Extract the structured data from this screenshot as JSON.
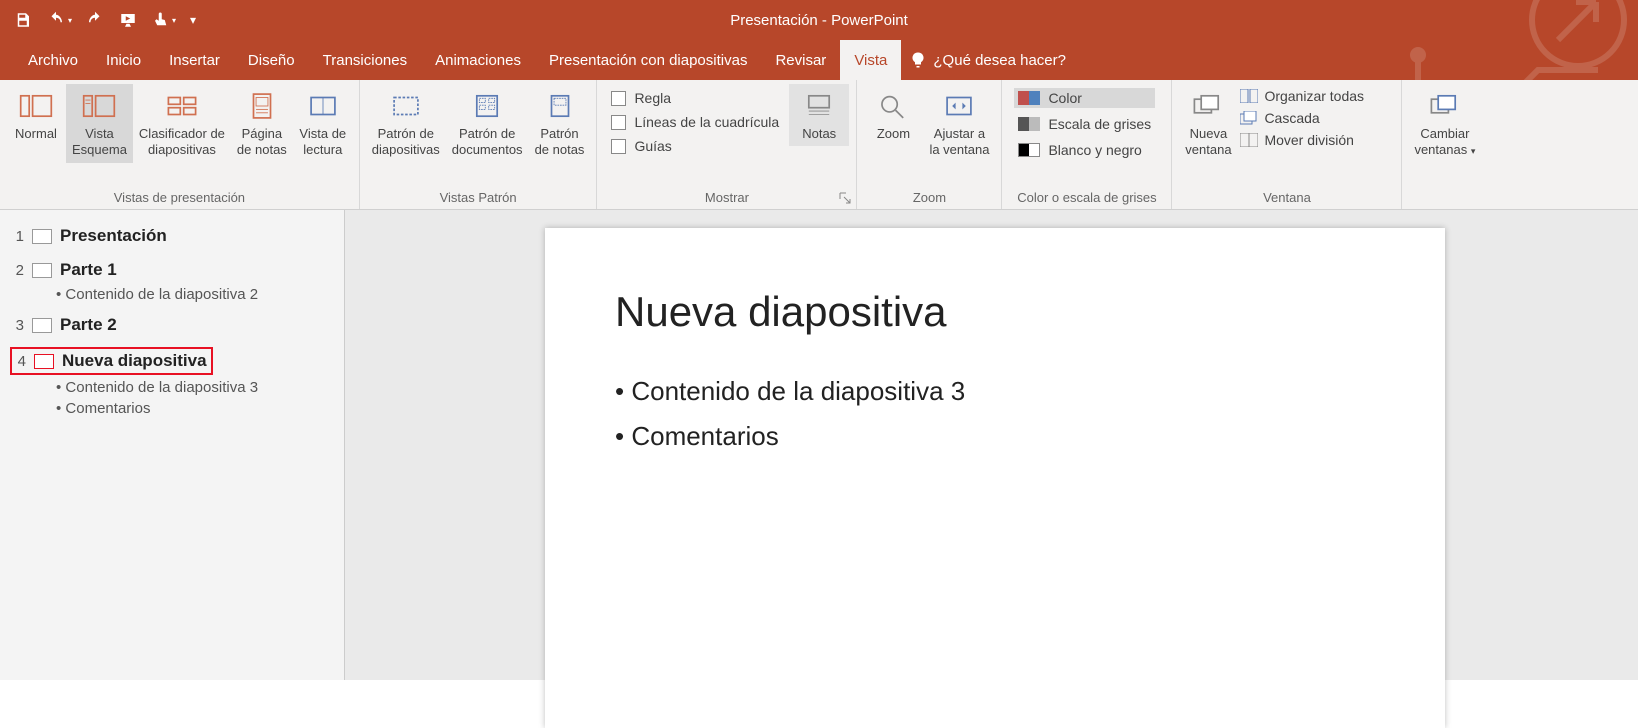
{
  "app": {
    "title": "Presentación - PowerPoint"
  },
  "tabs": {
    "items": [
      "Archivo",
      "Inicio",
      "Insertar",
      "Diseño",
      "Transiciones",
      "Animaciones",
      "Presentación con diapositivas",
      "Revisar",
      "Vista"
    ],
    "active": "Vista",
    "tell_me": "¿Qué desea hacer?"
  },
  "ribbon": {
    "groups": {
      "presentation_views": {
        "label": "Vistas de presentación",
        "normal": "Normal",
        "outline": "Vista\nEsquema",
        "sorter": "Clasificador de\ndiapositivas",
        "notes_page": "Página\nde notas",
        "reading": "Vista de\nlectura"
      },
      "master_views": {
        "label": "Vistas Patrón",
        "slide_master": "Patrón de\ndiapositivas",
        "handout_master": "Patrón de\ndocumentos",
        "notes_master": "Patrón\nde notas"
      },
      "show": {
        "label": "Mostrar",
        "ruler": "Regla",
        "gridlines": "Líneas de la cuadrícula",
        "guides": "Guías",
        "notes": "Notas"
      },
      "zoom": {
        "label": "Zoom",
        "zoom": "Zoom",
        "fit": "Ajustar a\nla ventana"
      },
      "color": {
        "label": "Color o escala de grises",
        "color": "Color",
        "grayscale": "Escala de grises",
        "bw": "Blanco y negro"
      },
      "window": {
        "label": "Ventana",
        "new_window": "Nueva\nventana",
        "arrange_all": "Organizar todas",
        "cascade": "Cascada",
        "move_split": "Mover división",
        "switch": "Cambiar\nventanas"
      }
    }
  },
  "outline": {
    "slides": [
      {
        "num": "1",
        "title": "Presentación",
        "subs": []
      },
      {
        "num": "2",
        "title": "Parte 1",
        "subs": [
          "Contenido de la diapositiva 2"
        ]
      },
      {
        "num": "3",
        "title": "Parte 2",
        "subs": []
      },
      {
        "num": "4",
        "title": "Nueva diapositiva",
        "subs": [
          "Contenido de la diapositiva 3",
          "Comentarios"
        ],
        "selected": true
      }
    ]
  },
  "slide": {
    "title": "Nueva diapositiva",
    "bullets": [
      "Contenido de la diapositiva 3",
      "Comentarios"
    ]
  }
}
